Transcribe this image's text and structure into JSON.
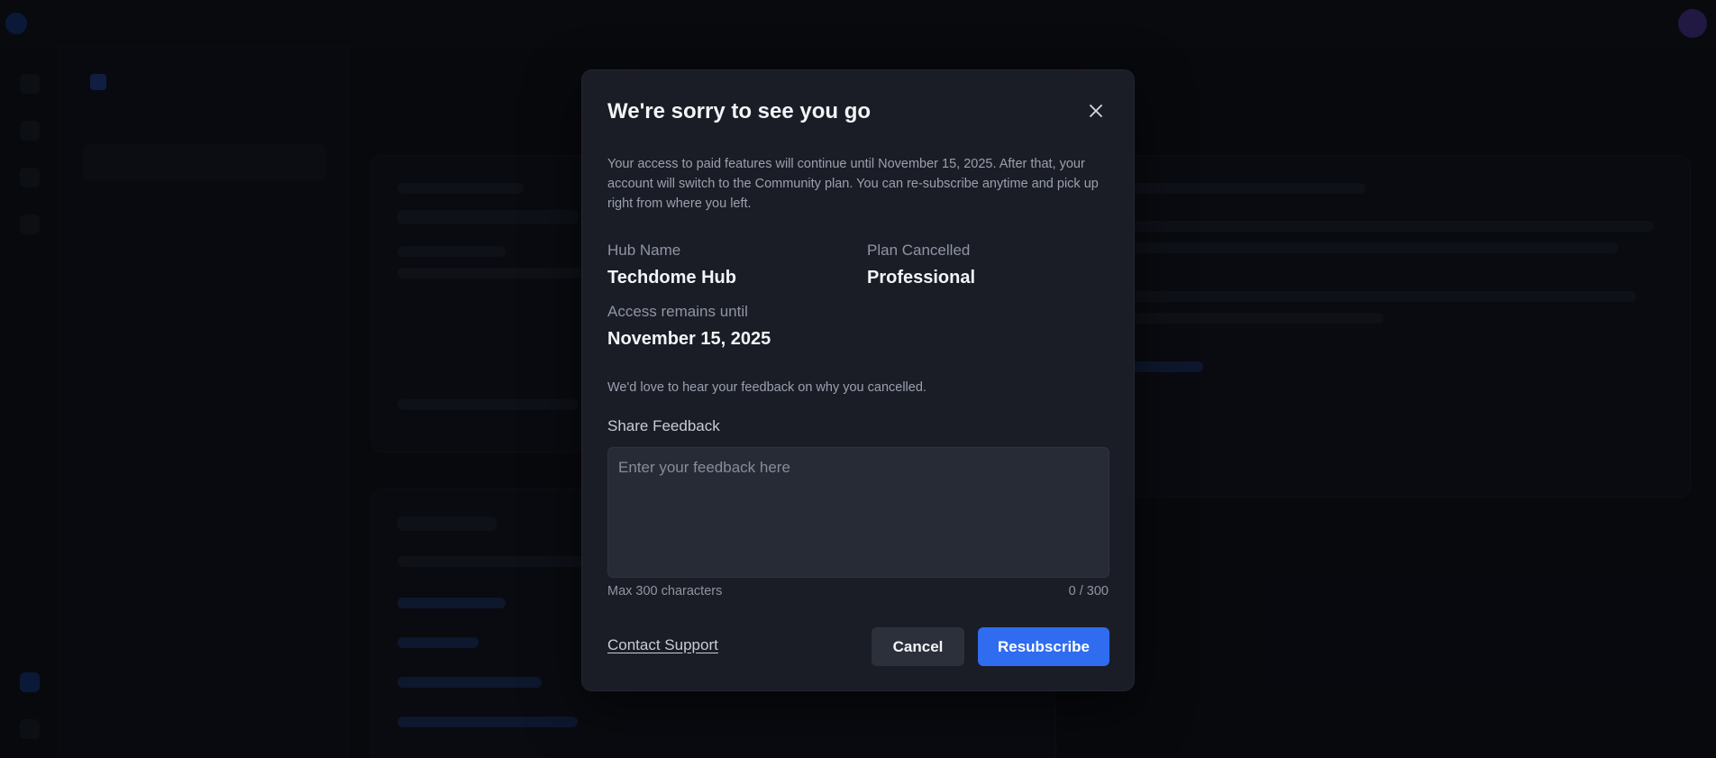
{
  "modal": {
    "title": "We're sorry to see you go",
    "intro": "Your access to paid features will continue until November 15, 2025. After that, your account will switch to the Community plan. You can re-subscribe anytime and pick up right from where you left.",
    "hub_name_label": "Hub Name",
    "hub_name_value": "Techdome Hub",
    "plan_label": "Plan Cancelled",
    "plan_value": "Professional",
    "access_label": "Access remains until",
    "access_value": "November 15, 2025",
    "feedback_prompt": "We'd love to hear your feedback on why you cancelled.",
    "feedback_label": "Share Feedback",
    "feedback_placeholder": "Enter your feedback here",
    "feedback_value": "",
    "max_hint": "Max 300 characters",
    "char_count": "0 / 300",
    "contact_support": "Contact Support",
    "cancel_label": "Cancel",
    "resubscribe_label": "Resubscribe",
    "close_icon": "close-icon"
  },
  "colors": {
    "accent": "#2f6cf0",
    "modal_bg": "#1a1d26",
    "overlay": "rgba(4,5,8,0.72)"
  }
}
